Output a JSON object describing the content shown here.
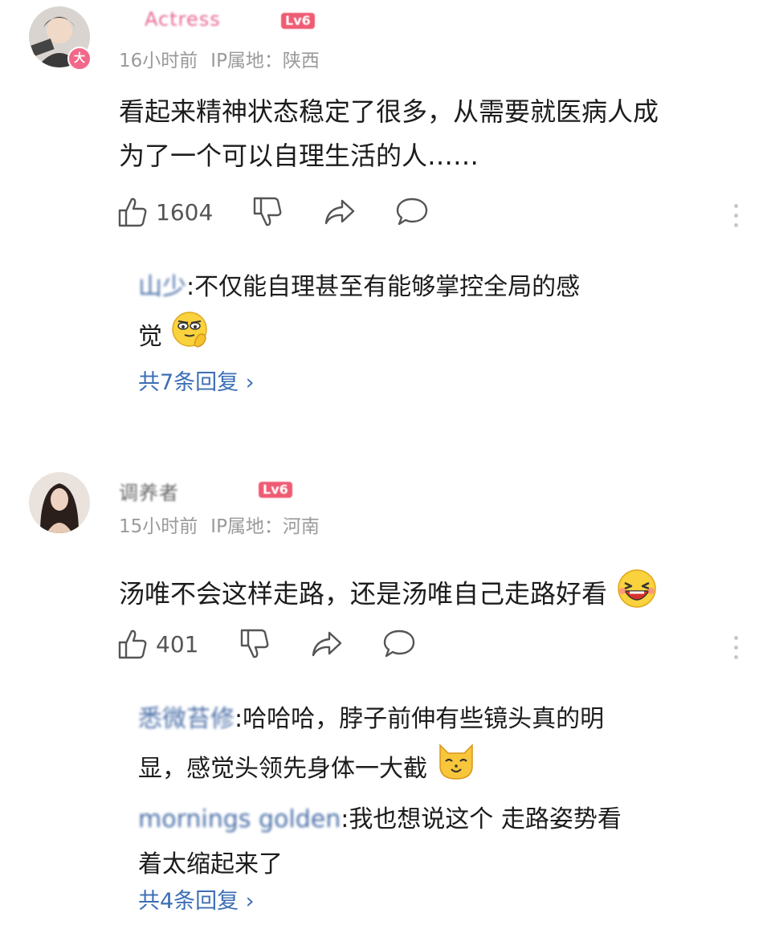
{
  "comments": [
    {
      "username": "Actress",
      "level_badge": "Lv6",
      "avatar_badge": "大",
      "time": "16小时前",
      "ip_label": "IP属地：陕西",
      "text_line1": "看起来精神状态稳定了很多，从需要就医病人成",
      "text_line2": "为了一个可以自理生活的人……",
      "likes": "1604",
      "replies": [
        {
          "name": "山少",
          "sep": ":",
          "line1": "不仅能自理甚至有能够掌控全局的感",
          "line2": "觉",
          "emoji": "smirk-emoji"
        }
      ],
      "reply_count": "共7条回复 ›"
    },
    {
      "username": "调养者",
      "level_badge": "Lv6",
      "time": "15小时前",
      "ip_label": "IP属地：河南",
      "text_line1": "汤唯不会这样走路，还是汤唯自己走路好看",
      "emoji": "laughing-emoji",
      "likes": "401",
      "replies": [
        {
          "name": "悉微苔修",
          "sep": ":",
          "line1": "哈哈哈，脖子前伸有些镜头真的明",
          "line2": "显，感觉头领先身体一大截",
          "emoji": "cat-emoji"
        },
        {
          "name": "mornings golden",
          "sep": ":",
          "line1": "我也想说这个 走路姿势看",
          "line2": "着太缩起来了"
        }
      ],
      "reply_count": "共4条回复 ›"
    }
  ],
  "colors": {
    "link": "#3c6fb4",
    "meta": "#9a9a9a",
    "level": "#ef5b73",
    "badge": "#f2688a"
  }
}
